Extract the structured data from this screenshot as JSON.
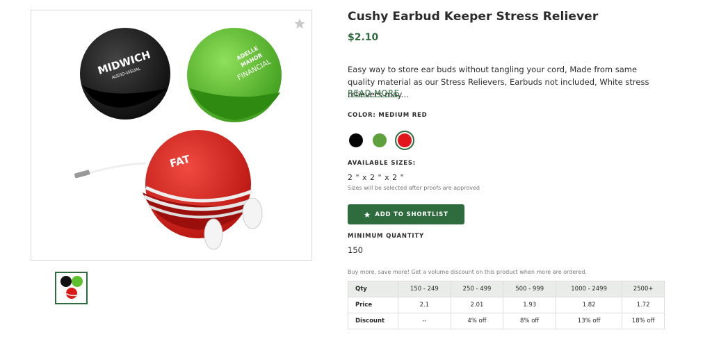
{
  "product": {
    "title": "Cushy Earbud Keeper Stress Reliever",
    "price": "$2.10",
    "description": "Easy way to store ear buds without tangling your cord, Made from same quality material as our Stress Relievers, Earbuds not included, White stress relievers may...",
    "read_more": "READ MORE",
    "images": {
      "black_ball_logo": "MIDWICH",
      "black_ball_sub": "AUDIO-VISUAL",
      "green_ball_logo_1": "ADELLE",
      "green_ball_logo_2": "MAHOR",
      "green_ball_logo_3": "FINANCIAL",
      "red_ball_logo": "FAT"
    }
  },
  "color": {
    "label": "COLOR: MEDIUM RED",
    "swatches": [
      {
        "name": "black",
        "hex": "#050505"
      },
      {
        "name": "green",
        "hex": "#5ea03c"
      },
      {
        "name": "medium red",
        "hex": "#e0161b",
        "selected": true
      }
    ]
  },
  "sizes": {
    "label": "AVAILABLE SIZES:",
    "value": "2 \" x 2 \" x 2 \"",
    "note": "Sizes will be selected after proofs are approved"
  },
  "shortlist_button": "ADD TO SHORTLIST",
  "min_quantity": {
    "label": "MINIMUM QUANTITY",
    "value": "150"
  },
  "volume_note": "Buy more, save more! Get a volume discount on this product when more are ordered.",
  "pricing_table": {
    "header": [
      "Qty",
      "150 - 249",
      "250 - 499",
      "500 - 999",
      "1000 - 2499",
      "2500+"
    ],
    "price_row": [
      "Price",
      "2.1",
      "2.01",
      "1.93",
      "1.82",
      "1.72"
    ],
    "discount_row": [
      "Discount",
      "--",
      "4% off",
      "8% off",
      "13% off",
      "18% off"
    ]
  },
  "colors": {
    "accent": "#2e6b3d",
    "border": "#d8d8d8"
  }
}
